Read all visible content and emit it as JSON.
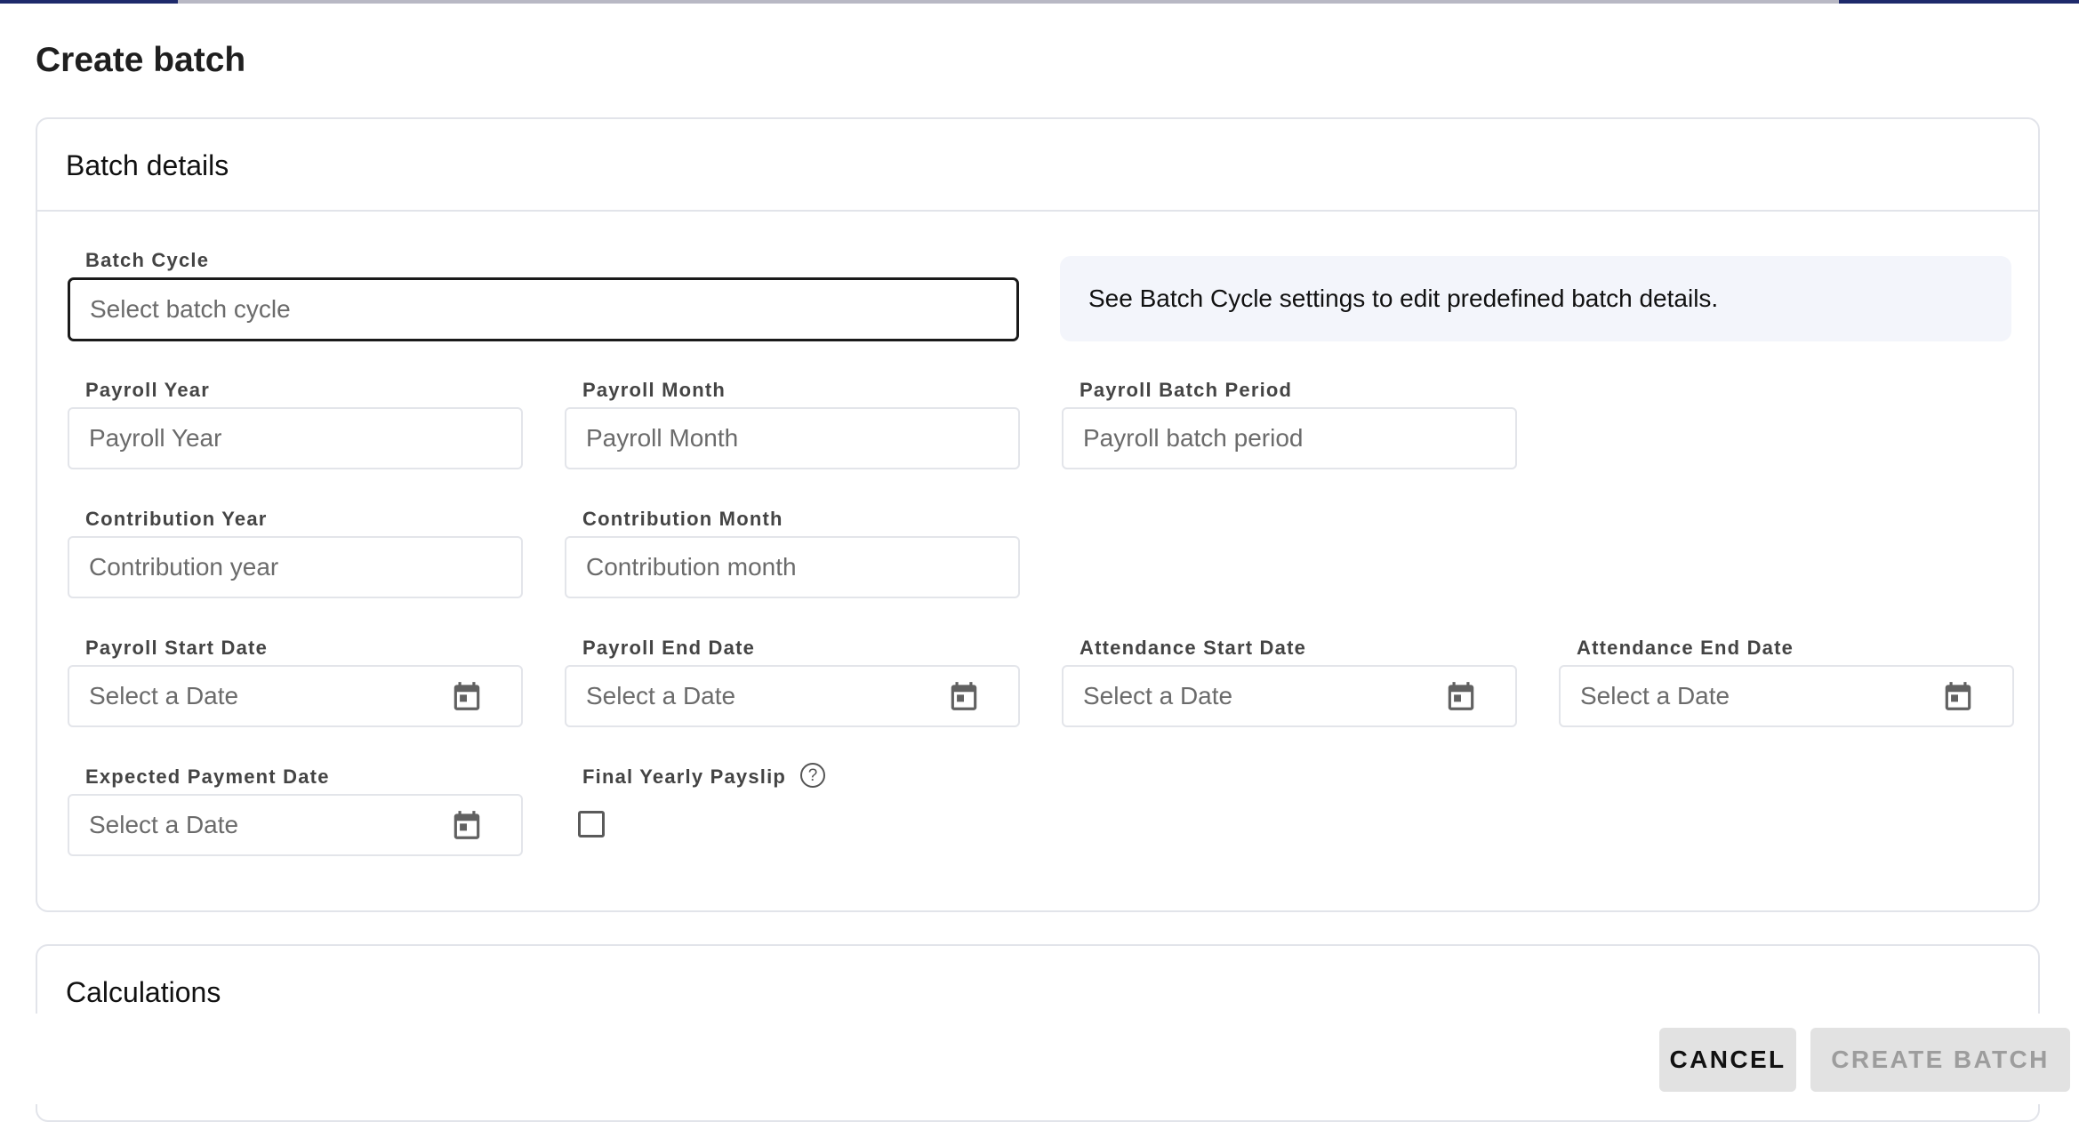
{
  "page": {
    "title": "Create batch"
  },
  "batch_details": {
    "title": "Batch details",
    "info_text": "See Batch Cycle settings to edit predefined batch details.",
    "fields": {
      "batch_cycle": {
        "label": "Batch Cycle",
        "placeholder": "Select batch cycle"
      },
      "payroll_year": {
        "label": "Payroll Year",
        "placeholder": "Payroll Year"
      },
      "payroll_month": {
        "label": "Payroll Month",
        "placeholder": "Payroll Month"
      },
      "payroll_batch_period": {
        "label": "Payroll Batch Period",
        "placeholder": "Payroll batch period"
      },
      "contribution_year": {
        "label": "Contribution Year",
        "placeholder": "Contribution year"
      },
      "contribution_month": {
        "label": "Contribution Month",
        "placeholder": "Contribution month"
      },
      "payroll_start_date": {
        "label": "Payroll Start Date",
        "placeholder": "Select a Date"
      },
      "payroll_end_date": {
        "label": "Payroll End Date",
        "placeholder": "Select a Date"
      },
      "attendance_start_date": {
        "label": "Attendance Start Date",
        "placeholder": "Select a Date"
      },
      "attendance_end_date": {
        "label": "Attendance End Date",
        "placeholder": "Select a Date"
      },
      "expected_payment_date": {
        "label": "Expected Payment Date",
        "placeholder": "Select a Date"
      },
      "final_yearly_payslip": {
        "label": "Final Yearly Payslip",
        "help": "?",
        "checked": false
      }
    }
  },
  "calculations": {
    "title": "Calculations"
  },
  "footer": {
    "cancel_label": "CANCEL",
    "create_label": "CREATE BATCH"
  },
  "colors": {
    "accent": "#1e2a6b",
    "info_bg": "#f3f5fb",
    "border": "#e2e4ea",
    "button_bg": "#e2e2e2",
    "disabled_text": "#9d9d9d"
  },
  "icons": {
    "date_picker": "calendar-icon",
    "help": "help-circle-icon"
  }
}
